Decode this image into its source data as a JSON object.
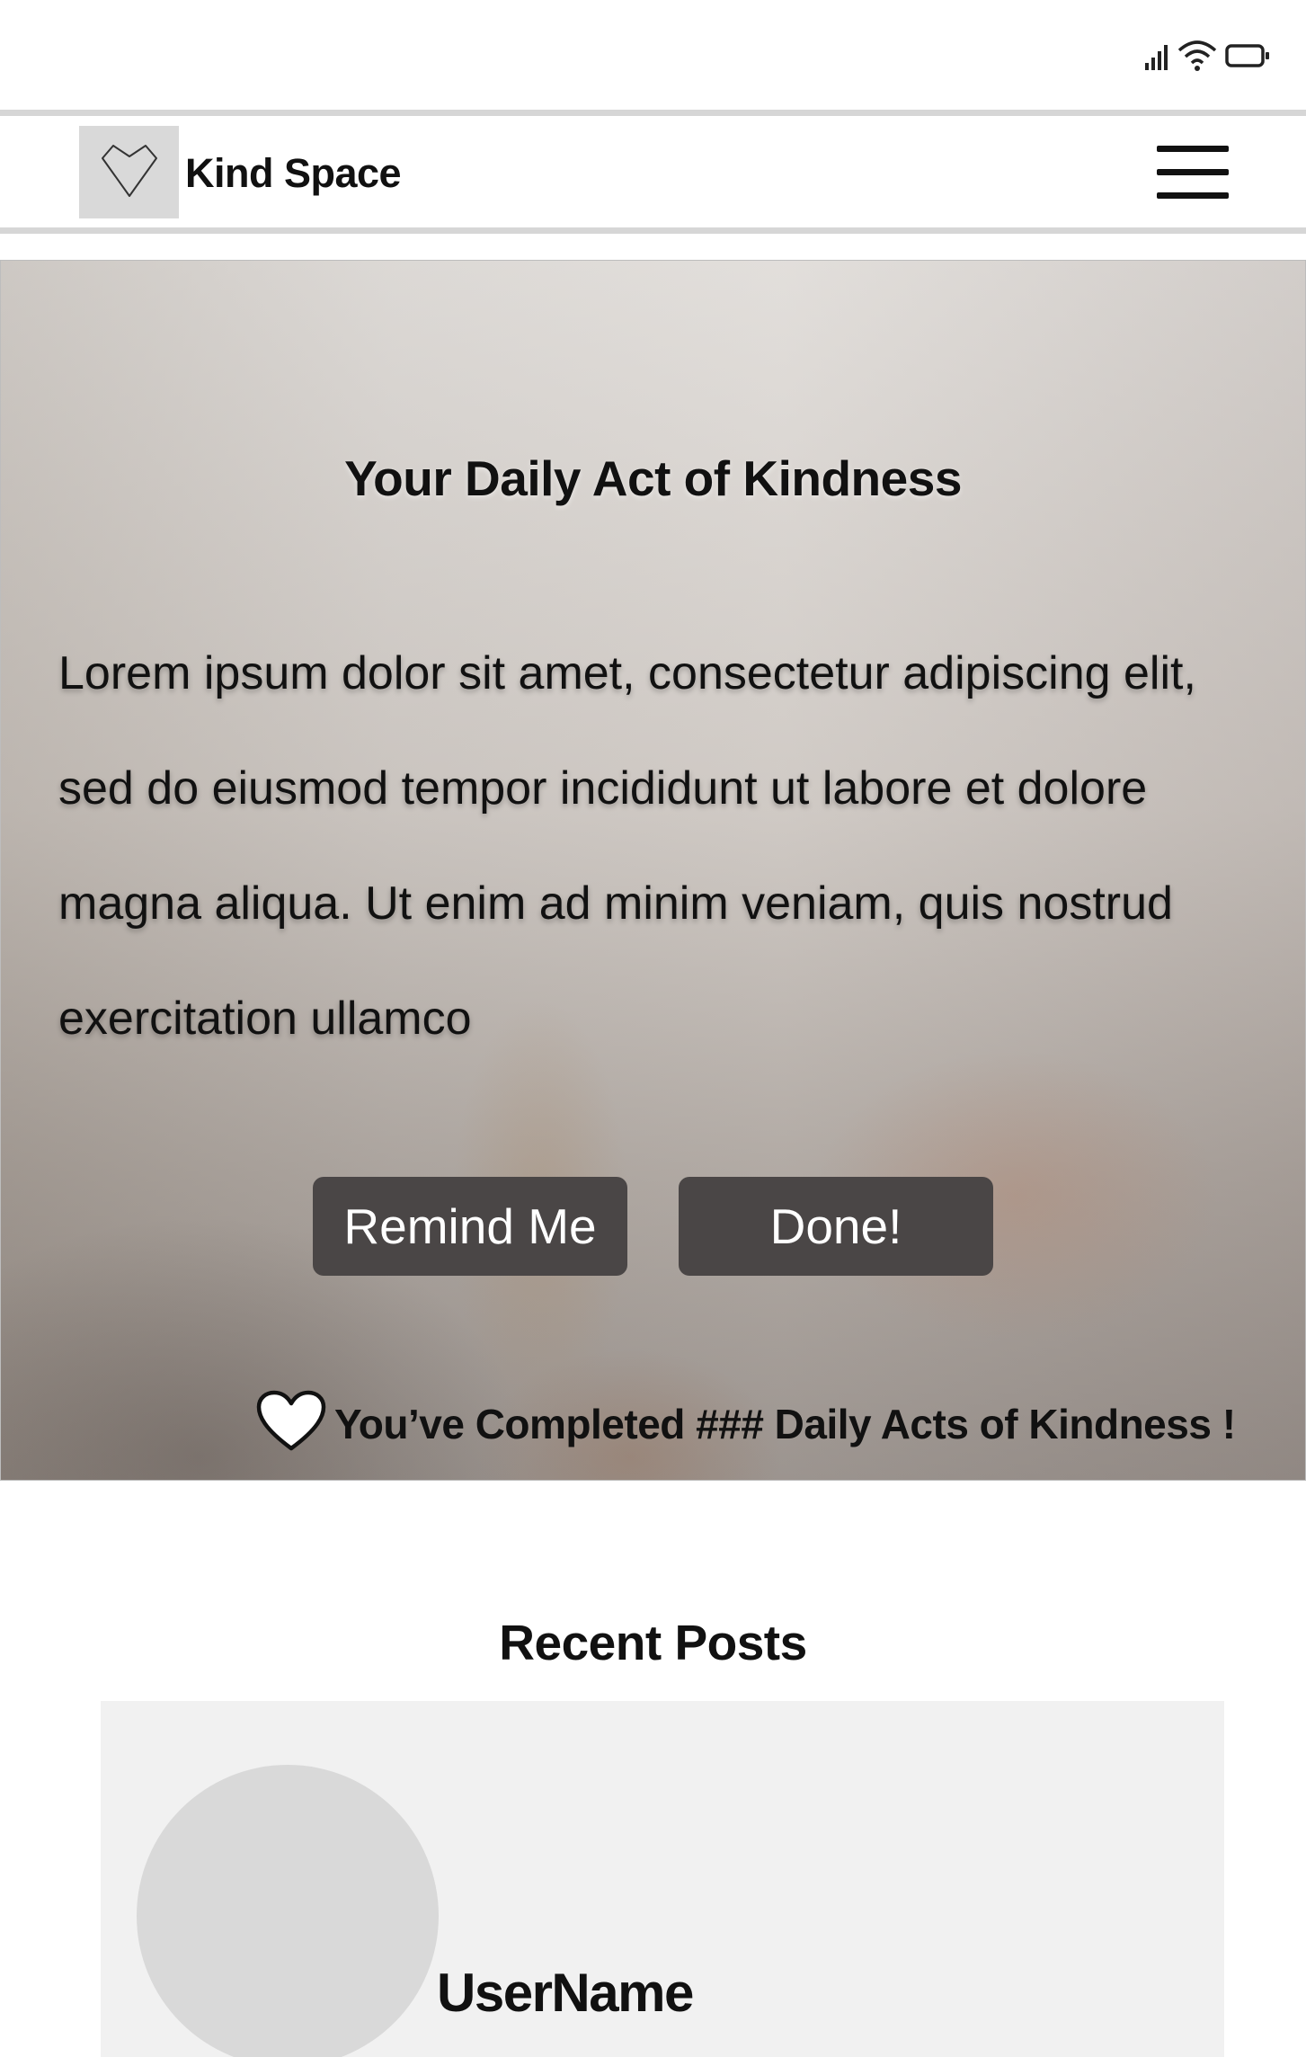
{
  "status_bar": {
    "icons": [
      "signal-icon",
      "wifi-icon",
      "battery-icon"
    ]
  },
  "app_bar": {
    "title": "Kind Space",
    "logo_icon": "heart-outline-icon",
    "menu_icon": "hamburger-menu-icon"
  },
  "daily_act": {
    "title": "Your Daily Act of Kindness",
    "body": "Lorem ipsum dolor sit amet, consectetur  adipiscing elit, sed do eiusmod tempor incididunt  ut labore et dolore magna aliqua. Ut enim ad minim veniam, quis nostrud exercitation ullamco",
    "remind_label": "Remind Me",
    "done_label": "Done!",
    "completed_text": "You’ve Completed ### Daily Acts of Kindness !",
    "completed_icon": "heart-icon"
  },
  "recent_posts": {
    "title": "Recent Posts",
    "posts": [
      {
        "username": "UserName"
      }
    ]
  },
  "colors": {
    "button_bg": "#4a4646",
    "logo_box": "#d9d9d9",
    "card_bg": "#f1f1f1",
    "divider": "#d6d6d6"
  }
}
